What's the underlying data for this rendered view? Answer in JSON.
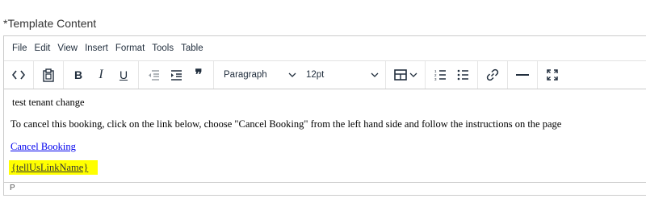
{
  "field_label": "*Template Content",
  "menubar": {
    "items": [
      "File",
      "Edit",
      "View",
      "Insert",
      "Format",
      "Tools",
      "Table"
    ]
  },
  "toolbar": {
    "source_code_icon": "code-icon",
    "paste_icon": "clipboard-icon",
    "bold_label": "B",
    "italic_label": "I",
    "underline_label": "U",
    "outdent_icon": "outdent-icon",
    "indent_icon": "indent-icon",
    "blockquote_label": "❞",
    "block_format": "Paragraph",
    "font_size": "12pt",
    "table_icon": "table-icon",
    "numlist_icon": "numbered-list-icon",
    "bullist_icon": "bullet-list-icon",
    "link_icon": "link-icon",
    "hr_icon": "horizontal-rule-icon",
    "fullscreen_icon": "fullscreen-icon"
  },
  "content": {
    "line1": "test tenant change",
    "line2": "To cancel this booking, click on the link below, choose \"Cancel Booking\" from the left hand side and follow the instructions on the page",
    "link": "Cancel Booking",
    "placeholder_link": "{tellUsLinkName}",
    "highlight_color": "#ffff00"
  },
  "statusbar": {
    "path": "P"
  }
}
